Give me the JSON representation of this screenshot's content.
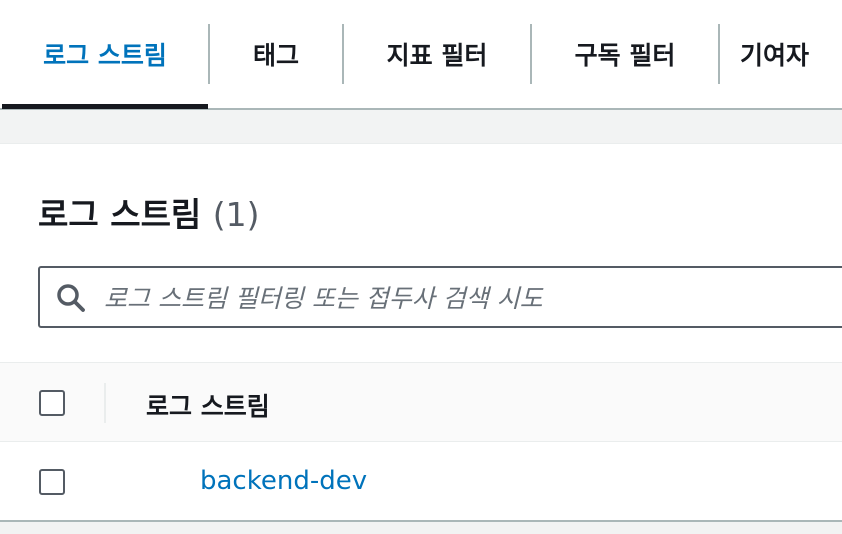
{
  "tabs": [
    {
      "label": "로그 스트림",
      "active": true
    },
    {
      "label": "태그",
      "active": false
    },
    {
      "label": "지표 필터",
      "active": false
    },
    {
      "label": "구독 필터",
      "active": false
    },
    {
      "label": "기여자",
      "active": false
    }
  ],
  "panel": {
    "title": "로그 스트림",
    "count": "(1)",
    "search": {
      "placeholder": "로그 스트림 필터링 또는 접두사 검색 시도",
      "value": ""
    }
  },
  "table": {
    "columns": [
      "로그 스트림"
    ],
    "rows": [
      {
        "log_stream": "backend-dev",
        "selected": false
      }
    ]
  },
  "colors": {
    "accent": "#0073bb",
    "text": "#16191f",
    "border": "#aab7b8"
  },
  "icons": {
    "search": "search-icon"
  }
}
